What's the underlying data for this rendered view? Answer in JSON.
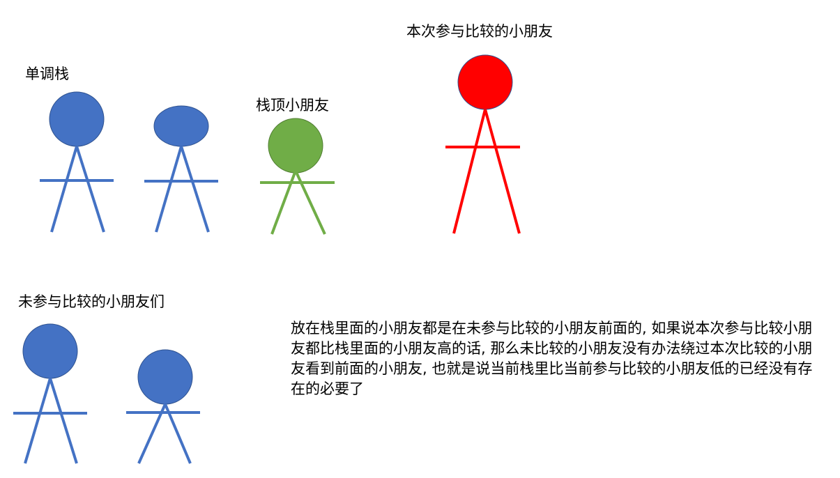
{
  "labels": {
    "mono_stack": "单调栈",
    "stack_top": "栈顶小朋友",
    "current": "本次参与比较的小朋友",
    "waiting": "未参与比较的小朋友们"
  },
  "explanation": "放在栈里面的小朋友都是在未参与比较的小朋友前面的, 如果说本次参与比较小朋友都比栈里面的小朋友高的话, 那么未比较的小朋友没有办法绕过本次比较的小朋友看到前面的小朋友, 也就是说当前栈里比当前参与比较的小朋友低的已经没有存在的必要了",
  "colors": {
    "stack_member": "#4472C4",
    "stack_top": "#70AD47",
    "current": "#FF0000",
    "outline": "#2F4F8F"
  }
}
